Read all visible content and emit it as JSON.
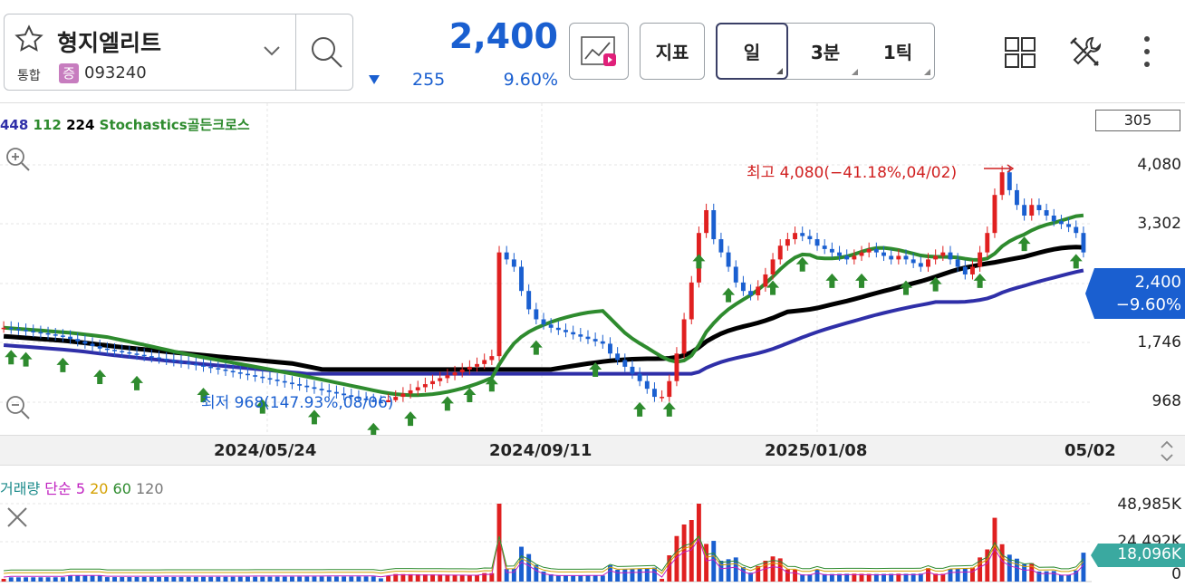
{
  "stock": {
    "name": "형지엘리트",
    "market": "통합",
    "margin_badge": "증",
    "code": "093240",
    "price": "2,400",
    "change": "255",
    "change_pct": "9.60%"
  },
  "toolbar": {
    "indicator_label": "지표",
    "periods": [
      "일",
      "3분",
      "1틱"
    ]
  },
  "indicators": {
    "ma_values": [
      "448",
      "112",
      "224"
    ],
    "signal": "Stochastics골든크로스",
    "count": "305"
  },
  "colors": {
    "up": "#e02020",
    "down": "#1a5fd0",
    "green": "#2e8b2e",
    "ma_black": "#000000",
    "ma_navy": "#2f2fa8",
    "accent_blue": "#1a5fd0"
  },
  "chart_data": [
    {
      "type": "candlestick",
      "y_ticks": [
        "4,080",
        "3,302",
        "1,746",
        "968"
      ],
      "x_ticks": [
        "2024/05/24",
        "2024/09/11",
        "2025/01/08",
        "05/02"
      ],
      "high_annotation": "최고 4,080(−41.18%,04/02)",
      "low_annotation": "최저 968(147.93%,08/06)",
      "current_price_tag": "2,400",
      "current_change_tag": "−9.60%",
      "series": [
        {
          "name": "448"
        },
        {
          "name": "112"
        },
        {
          "name": "224"
        }
      ],
      "close_approx": [
        1520,
        1510,
        1500,
        1490,
        1480,
        1470,
        1460,
        1450,
        1440,
        1420,
        1400,
        1380,
        1360,
        1340,
        1330,
        1320,
        1310,
        1300,
        1290,
        1280,
        1270,
        1260,
        1250,
        1240,
        1230,
        1220,
        1210,
        1200,
        1190,
        1180,
        1170,
        1160,
        1150,
        1140,
        1130,
        1120,
        1110,
        1100,
        1090,
        1080,
        1070,
        1060,
        1050,
        1040,
        1030,
        1020,
        1010,
        1000,
        990,
        980,
        970,
        968,
        980,
        1000,
        1020,
        1040,
        1060,
        1080,
        1100,
        1120,
        1140,
        1160,
        1180,
        1200,
        1220,
        1250,
        1280,
        2400,
        2300,
        2200,
        1900,
        1700,
        1600,
        1550,
        1520,
        1500,
        1480,
        1460,
        1440,
        1420,
        1400,
        1380,
        1300,
        1250,
        1200,
        1150,
        1100,
        1050,
        1000,
        1000,
        1100,
        1300,
        1600,
        2000,
        2700,
        3100,
        2600,
        2400,
        2200,
        2000,
        1900,
        1850,
        1950,
        2100,
        2300,
        2500,
        2600,
        2700,
        2650,
        2600,
        2500,
        2450,
        2400,
        2350,
        2300,
        2350,
        2400,
        2450,
        2400,
        2350,
        2300,
        2350,
        2300,
        2250,
        2200,
        2300,
        2350,
        2400,
        2300,
        2200,
        2100,
        2200,
        2400,
        2700,
        3400,
        3900,
        3500,
        3200,
        3000,
        3200,
        3100,
        3000,
        2900,
        2850,
        2800,
        2700,
        2400
      ]
    },
    {
      "type": "bar",
      "title": "거래량",
      "legend": [
        "단순",
        "5",
        "20",
        "60",
        "120"
      ],
      "y_ticks": [
        "48,985K",
        "24,492K",
        "0"
      ],
      "current_tag": "18,096K",
      "ylim": [
        0,
        48985
      ]
    }
  ]
}
